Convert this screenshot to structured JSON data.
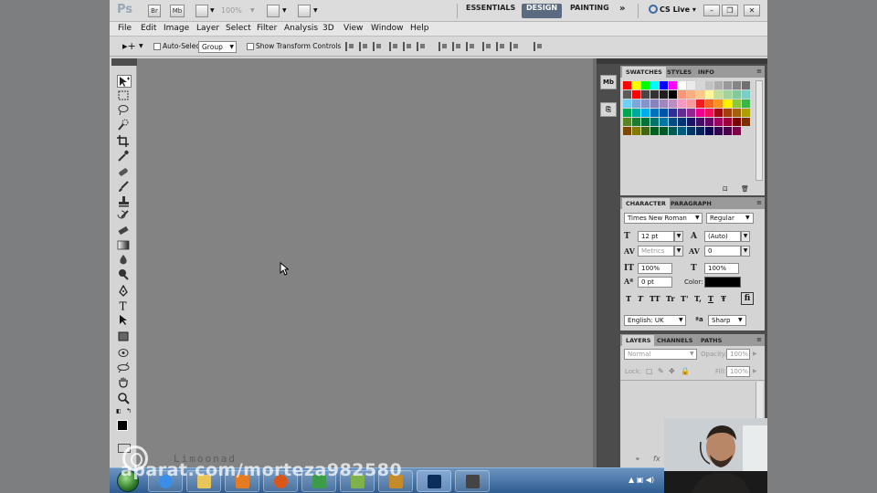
{
  "app": {
    "logo": "Ps",
    "bridge_btn": "Br",
    "minibridge_btn": "Mb",
    "zoom": "100%",
    "workspaces": [
      "ESSENTIALS",
      "DESIGN",
      "PAINTING"
    ],
    "workspaces_more": "»",
    "cs_live": "CS Live"
  },
  "menu": [
    "File",
    "Edit",
    "Image",
    "Layer",
    "Select",
    "Filter",
    "Analysis",
    "3D",
    "View",
    "Window",
    "Help"
  ],
  "options": {
    "auto_select_label": "Auto-Select:",
    "auto_select_value": "Group",
    "show_transform_label": "Show Transform Controls"
  },
  "panels": {
    "swatches_tabs": [
      "SWATCHES",
      "STYLES",
      "INFO"
    ],
    "character_tabs": [
      "CHARACTER",
      "PARAGRAPH"
    ],
    "layers_tabs": [
      "LAYERS",
      "CHANNELS",
      "PATHS"
    ],
    "dock_mb": "Mb"
  },
  "character": {
    "font_family": "Times New Roman",
    "font_style": "Regular",
    "font_size": "12 pt",
    "leading": "(Auto)",
    "kerning": "Metrics",
    "tracking": "0",
    "vertical_scale": "100%",
    "horizontal_scale": "100%",
    "baseline_shift": "0 pt",
    "color_label": "Color:",
    "type_buttons": [
      "T",
      "T",
      "TT",
      "Tr",
      "T'",
      "T,",
      "T",
      "Ŧ"
    ],
    "language": "English: UK",
    "antialias_icon": "ªa",
    "antialias": "Sharp"
  },
  "layers": {
    "blend_mode": "Normal",
    "opacity_label": "Opacity:",
    "opacity": "100%",
    "lock_label": "Lock:",
    "fill_label": "Fill:",
    "fill": "100%"
  },
  "watermarks": {
    "url": "aparat.com/morteza982580",
    "limoonad": "Limoonad"
  },
  "swatch_colors": [
    "#ff0000",
    "#ffff00",
    "#00ff00",
    "#00ffff",
    "#0000ff",
    "#ff00ff",
    "#ffffff",
    "#ebebeb",
    "#d6d6d6",
    "#c2c2c2",
    "#adadad",
    "#999999",
    "#858585",
    "#707070",
    "#5c5c5c",
    "#ff0000",
    "#474747",
    "#333333",
    "#1f1f1f",
    "#000000",
    "#f7977a",
    "#f9ad81",
    "#fdc68a",
    "#fff79a",
    "#c4df9b",
    "#a2d39c",
    "#82ca9d",
    "#7bcdc8",
    "#6ecff6",
    "#7ea7d8",
    "#8493ca",
    "#8882be",
    "#a187be",
    "#bc8dbf",
    "#f49ac2",
    "#f6989d",
    "#ed1c24",
    "#f26522",
    "#f7941d",
    "#fff200",
    "#8dc73f",
    "#39b54a",
    "#00a651",
    "#00a99d",
    "#00aeef",
    "#0072bc",
    "#0054a6",
    "#2e3192",
    "#662d91",
    "#92278f",
    "#ec008c",
    "#ed145b",
    "#9e0b0f",
    "#a0410d",
    "#a36209",
    "#aba000",
    "#598527",
    "#1a7b30",
    "#007236",
    "#00746b",
    "#0076a3",
    "#004b80",
    "#003471",
    "#1b1464",
    "#440e62",
    "#630460",
    "#9e005d",
    "#9e0039",
    "#790000",
    "#7b2e00",
    "#7d4900",
    "#827b00",
    "#406618",
    "#005e20",
    "#005826",
    "#005952",
    "#005b7f",
    "#003663",
    "#002157",
    "#0d004c",
    "#32004b",
    "#4b0049",
    "#7b0046",
    "#7a0026",
    "#c7b299",
    "#998675",
    "#736357",
    "#534741",
    "#37302d",
    "#c69c6d",
    "#a67c52",
    "#8c6239",
    "#754c24",
    "#603913",
    "#603913",
    "#603913"
  ]
}
